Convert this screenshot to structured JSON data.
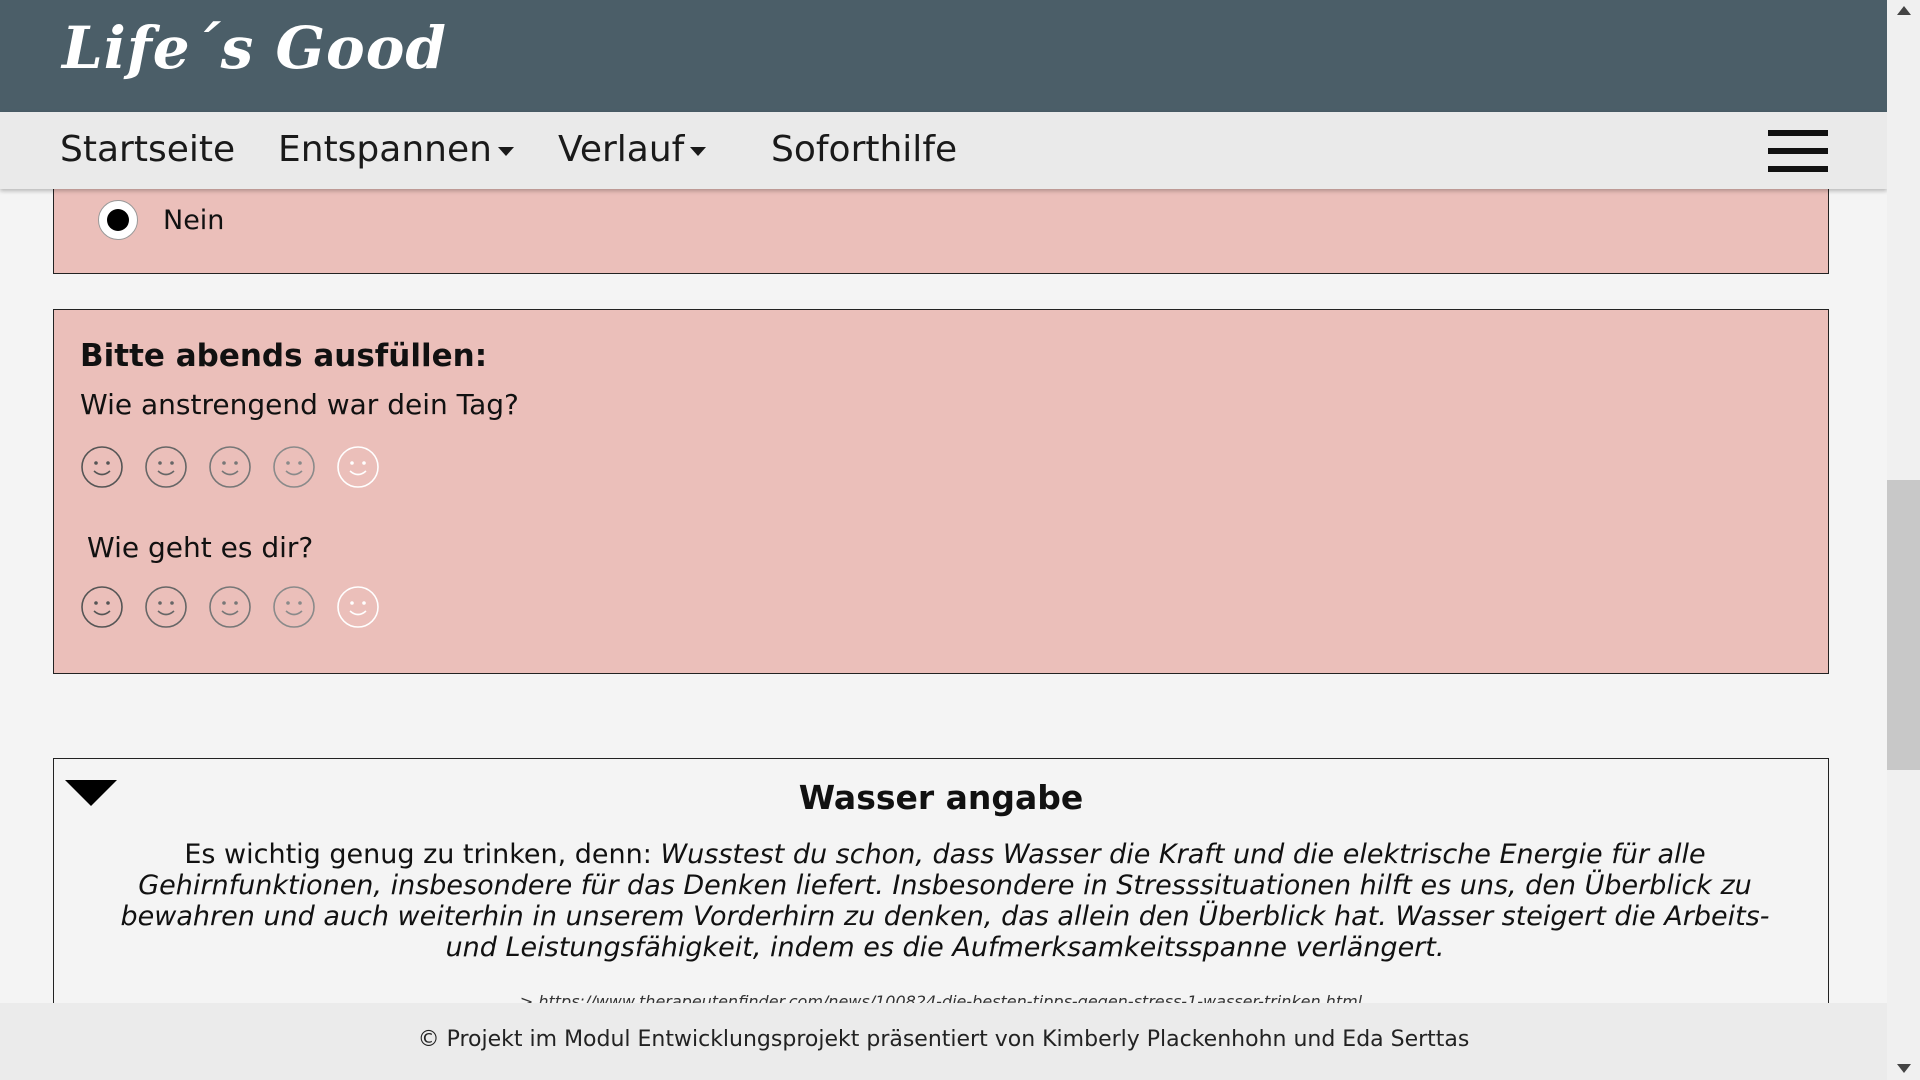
{
  "header": {
    "logo": "Life´s Good"
  },
  "nav": {
    "items": [
      {
        "label": "Startseite"
      },
      {
        "label": "Entspannen"
      },
      {
        "label": "Verlauf"
      },
      {
        "label": "Soforthilfe"
      }
    ],
    "menu_icon": "hamburger-icon"
  },
  "morning": {
    "radio_label": "Nein",
    "radio_selected": true
  },
  "evening": {
    "title": "Bitte abends ausfüllen:",
    "question_day": "Wie anstrengend war dein Tag?",
    "question_feel": "Wie geht es dir?",
    "day_rating_count": 5,
    "feel_rating_count": 5
  },
  "water": {
    "title": "Wasser angabe",
    "lead": "Es wichtig genug zu trinken, denn: ",
    "text": "Wusstest du schon, dass Wasser die Kraft und die elektrische Energie für alle Gehirnfunktionen, insbesondere für das Denken liefert. Insbesondere in Stresssituationen hilft es uns, den Überblick zu bewahren und auch weiterhin in unserem Vorderhirn zu denken, das allein den Überblick hat. Wasser steigert die Arbeits- und Leistungsfähigkeit, indem es die Aufmerksamkeitsspanne verlängert.",
    "source": "> https://www.therapeutenfinder.com/news/100824-die-besten-tipps-gegen-stress-1-wasser-trinken.html"
  },
  "footer": {
    "text": "© Projekt im Modul Entwicklungsprojekt präsentiert von Kimberly Plackenhohn und Eda Serttas"
  },
  "colors": {
    "header_bg": "#4b5e68",
    "card_pink": "#ebbfba",
    "nav_bg": "#eaeaea"
  }
}
